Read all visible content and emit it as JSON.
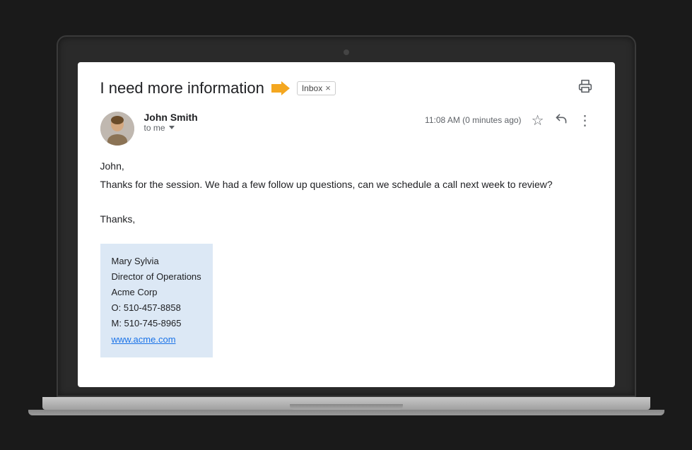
{
  "email": {
    "subject": "I need more information",
    "tag_label": "Inbox",
    "tag_close": "×",
    "sender_name": "John Smith",
    "sender_to": "to me",
    "timestamp": "11:08 AM (0 minutes ago)",
    "body_greeting": "John,",
    "body_line1": "Thanks for the session.   We had a few follow up questions, can we schedule a call next week to review?",
    "body_sign": "Thanks,",
    "sig_name": "Mary Sylvia",
    "sig_title": "Director of Operations",
    "sig_company": "Acme Corp",
    "sig_office": "O: 510-457-8858",
    "sig_mobile": "M: 510-745-8965",
    "sig_website": "www.acme.com"
  },
  "icons": {
    "forward": "▶",
    "print": "🖨",
    "star": "☆",
    "reply": "↩",
    "more": "⋮"
  }
}
